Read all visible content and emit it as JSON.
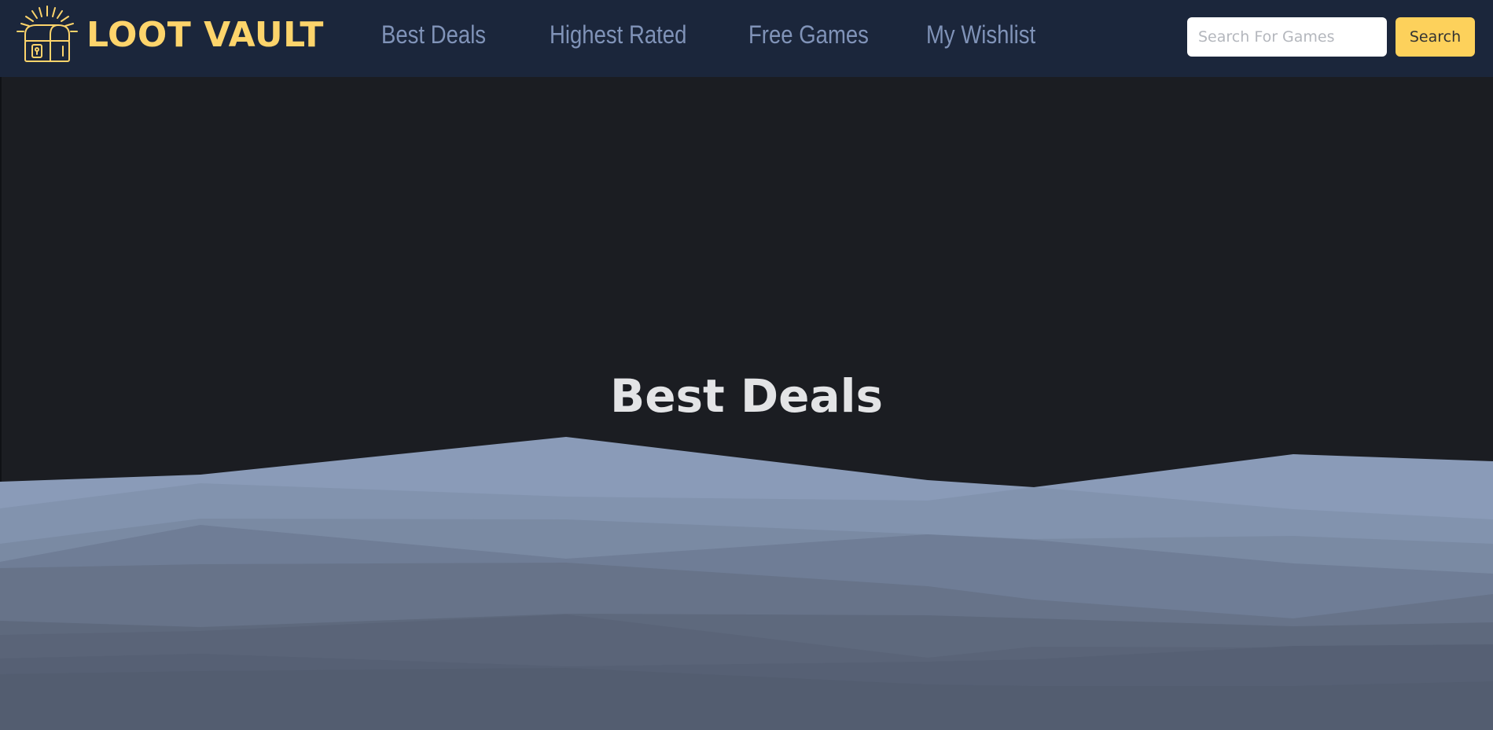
{
  "brand": {
    "name": "LOOT VAULT",
    "color": "#fdd46b",
    "logo_icon": "treasure-chest-icon"
  },
  "nav": {
    "links": [
      {
        "label": "Best Deals"
      },
      {
        "label": "Highest Rated"
      },
      {
        "label": "Free Games"
      },
      {
        "label": "My Wishlist"
      }
    ],
    "link_color": "#8093b8",
    "background": "#1b263b"
  },
  "search": {
    "placeholder": "Search For Games",
    "value": "",
    "button_label": "Search",
    "button_color": "#fdd15b"
  },
  "hero": {
    "title": "Best Deals",
    "background": "#1b1d22",
    "wave_colors": [
      "#8a9bb8",
      "#8293ae",
      "#7a8aa3",
      "#6f7d96",
      "#677389",
      "#5e697d",
      "#566074"
    ]
  }
}
